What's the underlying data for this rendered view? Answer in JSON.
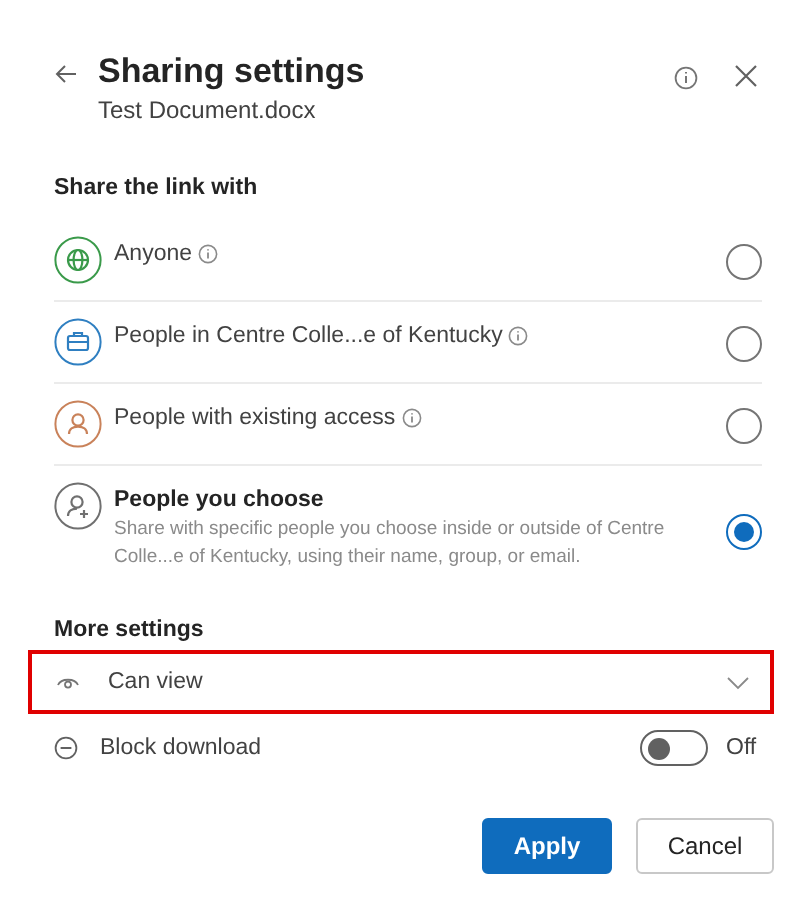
{
  "header": {
    "title": "Sharing settings",
    "subtitle": "Test Document.docx"
  },
  "share_section": {
    "heading": "Share the link with",
    "options": [
      {
        "kind": "globe",
        "label": "Anyone",
        "color": "#3a9a4a",
        "info": true,
        "selected": false
      },
      {
        "kind": "briefcase",
        "label": "People in Centre Colle...e of Kentucky",
        "color": "#2f7fc1",
        "info": true,
        "selected": false
      },
      {
        "kind": "person",
        "label": "People with existing access",
        "color": "#c9825a",
        "info": true,
        "selected": false
      },
      {
        "kind": "person-add",
        "label": "People you choose",
        "description": "Share with specific people you choose inside or outside of Centre Colle...e of Kentucky, using their name, group, or email.",
        "color": "#707070",
        "info": false,
        "selected": true
      }
    ]
  },
  "more_settings": {
    "heading": "More settings",
    "permission": {
      "value": "Can view",
      "highlighted": true
    },
    "block_download": {
      "label": "Block download",
      "on": false,
      "state_label": "Off"
    }
  },
  "buttons": [
    {
      "kind": "primary",
      "label": "Apply"
    },
    {
      "kind": "secondary",
      "label": "Cancel"
    }
  ]
}
